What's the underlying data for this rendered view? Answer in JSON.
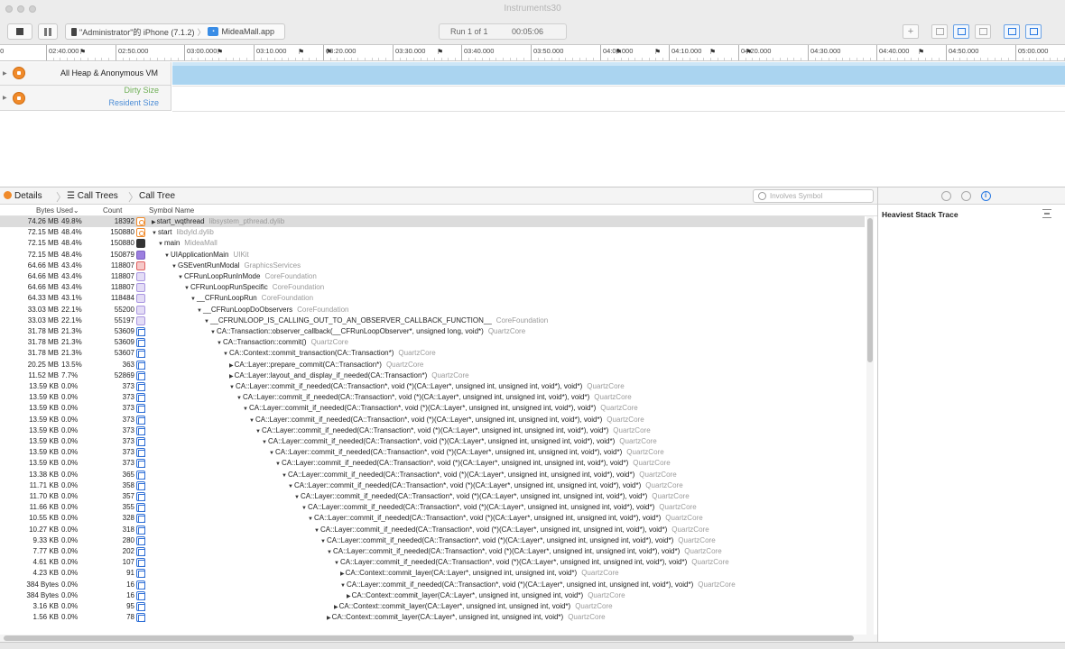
{
  "window": {
    "title": "Instruments30"
  },
  "toolbar": {
    "device_label": "\"Administrator\"的 iPhone (7.1.2)",
    "separator": "〉",
    "app_label": "MideaMall.app",
    "run_label": "Run 1 of 1",
    "run_time": "00:05:06",
    "add_label": "+"
  },
  "timeline": {
    "ticks": [
      "02:40.000",
      "02:50.000",
      "03:00.000",
      "03:10.000",
      "03:20.000",
      "03:30.000",
      "03:40.000",
      "03:50.000",
      "04:00.000",
      "04:10.000",
      "04:20.000",
      "04:30.000",
      "04:40.000",
      "04:50.000",
      "05:00.000"
    ],
    "leading_label": "00"
  },
  "tracks": [
    {
      "title": "All Heap & Anonymous VM",
      "icon": "allocations-icon"
    },
    {
      "title": "",
      "icon": "vm-tracker-icon",
      "subs": [
        "Dirty Size",
        "Resident Size"
      ]
    }
  ],
  "detailsbar": {
    "details_label": "Details",
    "call_trees_label": "Call Trees",
    "call_tree_label": "Call Tree",
    "search_placeholder": "Involves Symbol"
  },
  "columns": {
    "bytes": "Bytes Used",
    "count": "Count",
    "symbol": "Symbol Name"
  },
  "rows": [
    {
      "bytes": "74.26 MB",
      "pct": "49.8%",
      "count": "18392",
      "icon": "orange",
      "d": 0,
      "exp": "▶",
      "sym": "start_wqthread",
      "lib": "libsystem_pthread.dylib",
      "sel": true
    },
    {
      "bytes": "72.15 MB",
      "pct": "48.4%",
      "count": "150880",
      "icon": "orange",
      "d": 0,
      "exp": "▼",
      "sym": "start",
      "lib": "libdyld.dylib"
    },
    {
      "bytes": "72.15 MB",
      "pct": "48.4%",
      "count": "150880",
      "icon": "black",
      "d": 1,
      "exp": "▼",
      "sym": "main",
      "lib": "MideaMall"
    },
    {
      "bytes": "72.15 MB",
      "pct": "48.4%",
      "count": "150879",
      "icon": "user",
      "d": 2,
      "exp": "▼",
      "sym": "UIApplicationMain",
      "lib": "UIKit"
    },
    {
      "bytes": "64.66 MB",
      "pct": "43.4%",
      "count": "118807",
      "icon": "red",
      "d": 3,
      "exp": "▼",
      "sym": "GSEventRunModal",
      "lib": "GraphicsServices"
    },
    {
      "bytes": "64.66 MB",
      "pct": "43.4%",
      "count": "118807",
      "icon": "lav",
      "d": 4,
      "exp": "▼",
      "sym": "CFRunLoopRunInMode",
      "lib": "CoreFoundation"
    },
    {
      "bytes": "64.66 MB",
      "pct": "43.4%",
      "count": "118807",
      "icon": "lav",
      "d": 5,
      "exp": "▼",
      "sym": "CFRunLoopRunSpecific",
      "lib": "CoreFoundation"
    },
    {
      "bytes": "64.33 MB",
      "pct": "43.1%",
      "count": "118484",
      "icon": "lav",
      "d": 6,
      "exp": "▼",
      "sym": "__CFRunLoopRun",
      "lib": "CoreFoundation"
    },
    {
      "bytes": "33.03 MB",
      "pct": "22.1%",
      "count": "55200",
      "icon": "lav",
      "d": 7,
      "exp": "▼",
      "sym": "__CFRunLoopDoObservers",
      "lib": "CoreFoundation"
    },
    {
      "bytes": "33.03 MB",
      "pct": "22.1%",
      "count": "55197",
      "icon": "lav",
      "d": 8,
      "exp": "▼",
      "sym": "__CFRUNLOOP_IS_CALLING_OUT_TO_AN_OBSERVER_CALLBACK_FUNCTION__",
      "lib": "CoreFoundation"
    },
    {
      "bytes": "31.78 MB",
      "pct": "21.3%",
      "count": "53609",
      "icon": "blue",
      "d": 9,
      "exp": "▼",
      "sym": "CA::Transaction::observer_callback(__CFRunLoopObserver*, unsigned long, void*)",
      "lib": "QuartzCore"
    },
    {
      "bytes": "31.78 MB",
      "pct": "21.3%",
      "count": "53609",
      "icon": "blue",
      "d": 10,
      "exp": "▼",
      "sym": "CA::Transaction::commit()",
      "lib": "QuartzCore"
    },
    {
      "bytes": "31.78 MB",
      "pct": "21.3%",
      "count": "53607",
      "icon": "blue",
      "d": 11,
      "exp": "▼",
      "sym": "CA::Context::commit_transaction(CA::Transaction*)",
      "lib": "QuartzCore"
    },
    {
      "bytes": "20.25 MB",
      "pct": "13.5%",
      "count": "363",
      "icon": "blue",
      "d": 12,
      "exp": "▶",
      "sym": "CA::Layer::prepare_commit(CA::Transaction*)",
      "lib": "QuartzCore"
    },
    {
      "bytes": "11.52 MB",
      "pct": "7.7%",
      "count": "52869",
      "icon": "blue",
      "d": 12,
      "exp": "▶",
      "sym": "CA::Layer::layout_and_display_if_needed(CA::Transaction*)",
      "lib": "QuartzCore"
    },
    {
      "bytes": "13.59 KB",
      "pct": "0.0%",
      "count": "373",
      "icon": "blue",
      "d": 12,
      "exp": "▼",
      "sym": "CA::Layer::commit_if_needed(CA::Transaction*, void (*)(CA::Layer*, unsigned int, unsigned int, void*), void*)",
      "lib": "QuartzCore"
    },
    {
      "bytes": "13.59 KB",
      "pct": "0.0%",
      "count": "373",
      "icon": "blue",
      "d": 13,
      "exp": "▼",
      "sym": "CA::Layer::commit_if_needed(CA::Transaction*, void (*)(CA::Layer*, unsigned int, unsigned int, void*), void*)",
      "lib": "QuartzCore"
    },
    {
      "bytes": "13.59 KB",
      "pct": "0.0%",
      "count": "373",
      "icon": "blue",
      "d": 14,
      "exp": "▼",
      "sym": "CA::Layer::commit_if_needed(CA::Transaction*, void (*)(CA::Layer*, unsigned int, unsigned int, void*), void*)",
      "lib": "QuartzCore"
    },
    {
      "bytes": "13.59 KB",
      "pct": "0.0%",
      "count": "373",
      "icon": "blue",
      "d": 15,
      "exp": "▼",
      "sym": "CA::Layer::commit_if_needed(CA::Transaction*, void (*)(CA::Layer*, unsigned int, unsigned int, void*), void*)",
      "lib": "QuartzCore"
    },
    {
      "bytes": "13.59 KB",
      "pct": "0.0%",
      "count": "373",
      "icon": "blue",
      "d": 16,
      "exp": "▼",
      "sym": "CA::Layer::commit_if_needed(CA::Transaction*, void (*)(CA::Layer*, unsigned int, unsigned int, void*), void*)",
      "lib": "QuartzCore"
    },
    {
      "bytes": "13.59 KB",
      "pct": "0.0%",
      "count": "373",
      "icon": "blue",
      "d": 17,
      "exp": "▼",
      "sym": "CA::Layer::commit_if_needed(CA::Transaction*, void (*)(CA::Layer*, unsigned int, unsigned int, void*), void*)",
      "lib": "QuartzCore"
    },
    {
      "bytes": "13.59 KB",
      "pct": "0.0%",
      "count": "373",
      "icon": "blue",
      "d": 18,
      "exp": "▼",
      "sym": "CA::Layer::commit_if_needed(CA::Transaction*, void (*)(CA::Layer*, unsigned int, unsigned int, void*), void*)",
      "lib": "QuartzCore"
    },
    {
      "bytes": "13.59 KB",
      "pct": "0.0%",
      "count": "373",
      "icon": "blue",
      "d": 19,
      "exp": "▼",
      "sym": "CA::Layer::commit_if_needed(CA::Transaction*, void (*)(CA::Layer*, unsigned int, unsigned int, void*), void*)",
      "lib": "QuartzCore"
    },
    {
      "bytes": "13.38 KB",
      "pct": "0.0%",
      "count": "365",
      "icon": "blue",
      "d": 20,
      "exp": "▼",
      "sym": "CA::Layer::commit_if_needed(CA::Transaction*, void (*)(CA::Layer*, unsigned int, unsigned int, void*), void*)",
      "lib": "QuartzCore"
    },
    {
      "bytes": "11.71 KB",
      "pct": "0.0%",
      "count": "358",
      "icon": "blue",
      "d": 21,
      "exp": "▼",
      "sym": "CA::Layer::commit_if_needed(CA::Transaction*, void (*)(CA::Layer*, unsigned int, unsigned int, void*), void*)",
      "lib": "QuartzCore"
    },
    {
      "bytes": "11.70 KB",
      "pct": "0.0%",
      "count": "357",
      "icon": "blue",
      "d": 22,
      "exp": "▼",
      "sym": "CA::Layer::commit_if_needed(CA::Transaction*, void (*)(CA::Layer*, unsigned int, unsigned int, void*), void*)",
      "lib": "QuartzCore"
    },
    {
      "bytes": "11.66 KB",
      "pct": "0.0%",
      "count": "355",
      "icon": "blue",
      "d": 23,
      "exp": "▼",
      "sym": "CA::Layer::commit_if_needed(CA::Transaction*, void (*)(CA::Layer*, unsigned int, unsigned int, void*), void*)",
      "lib": "QuartzCore"
    },
    {
      "bytes": "10.55 KB",
      "pct": "0.0%",
      "count": "328",
      "icon": "blue",
      "d": 24,
      "exp": "▼",
      "sym": "CA::Layer::commit_if_needed(CA::Transaction*, void (*)(CA::Layer*, unsigned int, unsigned int, void*), void*)",
      "lib": "QuartzCore"
    },
    {
      "bytes": "10.27 KB",
      "pct": "0.0%",
      "count": "318",
      "icon": "blue",
      "d": 25,
      "exp": "▼",
      "sym": "CA::Layer::commit_if_needed(CA::Transaction*, void (*)(CA::Layer*, unsigned int, unsigned int, void*), void*)",
      "lib": "QuartzCore"
    },
    {
      "bytes": "9.33 KB",
      "pct": "0.0%",
      "count": "280",
      "icon": "blue",
      "d": 26,
      "exp": "▼",
      "sym": "CA::Layer::commit_if_needed(CA::Transaction*, void (*)(CA::Layer*, unsigned int, unsigned int, void*), void*)",
      "lib": "QuartzCore"
    },
    {
      "bytes": "7.77 KB",
      "pct": "0.0%",
      "count": "202",
      "icon": "blue",
      "d": 27,
      "exp": "▼",
      "sym": "CA::Layer::commit_if_needed(CA::Transaction*, void (*)(CA::Layer*, unsigned int, unsigned int, void*), void*)",
      "lib": "QuartzCore"
    },
    {
      "bytes": "4.61 KB",
      "pct": "0.0%",
      "count": "107",
      "icon": "blue",
      "d": 28,
      "exp": "▼",
      "sym": "CA::Layer::commit_if_needed(CA::Transaction*, void (*)(CA::Layer*, unsigned int, unsigned int, void*), void*)",
      "lib": "QuartzCore"
    },
    {
      "bytes": "4.23 KB",
      "pct": "0.0%",
      "count": "91",
      "icon": "blue",
      "d": 29,
      "exp": "▶",
      "sym": "CA::Context::commit_layer(CA::Layer*, unsigned int, unsigned int, void*)",
      "lib": "QuartzCore"
    },
    {
      "bytes": "384 Bytes",
      "pct": "0.0%",
      "count": "16",
      "icon": "blue",
      "d": 29,
      "exp": "▼",
      "sym": "CA::Layer::commit_if_needed(CA::Transaction*, void (*)(CA::Layer*, unsigned int, unsigned int, void*), void*)",
      "lib": "QuartzCore"
    },
    {
      "bytes": "384 Bytes",
      "pct": "0.0%",
      "count": "16",
      "icon": "blue",
      "d": 30,
      "exp": "▶",
      "sym": "CA::Context::commit_layer(CA::Layer*, unsigned int, unsigned int, void*)",
      "lib": "QuartzCore"
    },
    {
      "bytes": "3.16 KB",
      "pct": "0.0%",
      "count": "95",
      "icon": "blue",
      "d": 28,
      "exp": "▶",
      "sym": "CA::Context::commit_layer(CA::Layer*, unsigned int, unsigned int, void*)",
      "lib": "QuartzCore"
    },
    {
      "bytes": "1.56 KB",
      "pct": "0.0%",
      "count": "78",
      "icon": "blue",
      "d": 27,
      "exp": "▶",
      "sym": "CA::Context::commit_layer(CA::Layer*, unsigned int, unsigned int, void*)",
      "lib": "QuartzCore"
    }
  ],
  "rightpanel": {
    "title": "Heaviest Stack Trace"
  }
}
